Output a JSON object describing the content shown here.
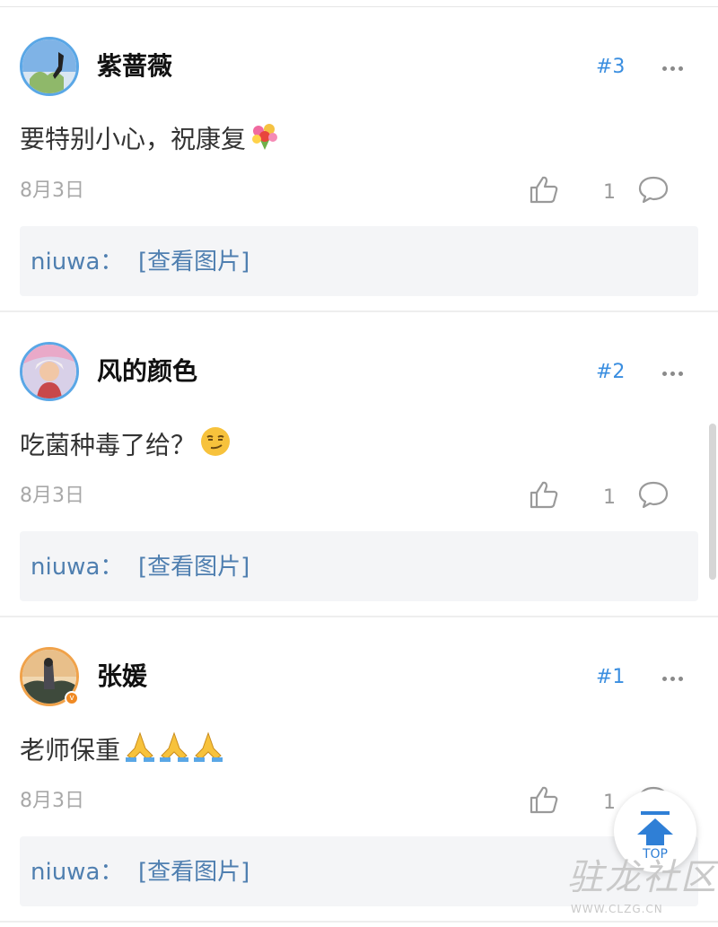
{
  "comments": [
    {
      "username": "紫蔷薇",
      "floor": "#3",
      "content": "要特别小心，祝康复",
      "emoji": "bouquet-emoji",
      "date": "8月3日",
      "like_count": "1",
      "reply": {
        "user": "niuwa：",
        "text": "[查看图片]"
      }
    },
    {
      "username": "风的颜色",
      "floor": "#2",
      "content": "吃菌种毒了给？",
      "emoji": "smirk-emoji",
      "date": "8月3日",
      "like_count": "1",
      "reply": {
        "user": "niuwa：",
        "text": "[查看图片]"
      }
    },
    {
      "username": "张媛",
      "floor": "#1",
      "content": "老师保重",
      "emoji": "praying-hands-emoji",
      "date": "8月3日",
      "like_count": "1",
      "verified_badge": "v",
      "reply": {
        "user": "niuwa：",
        "text": "[查看图片]"
      }
    }
  ],
  "top_button": {
    "label": "TOP"
  },
  "watermark": {
    "main": "驻龙社区",
    "url": "WWW.CLZG.CN"
  },
  "colors": {
    "accent": "#3a8ee0",
    "reply_text": "#4f7fb0",
    "meta_gray": "#a8a8a8",
    "reply_bg": "#f4f5f7"
  }
}
